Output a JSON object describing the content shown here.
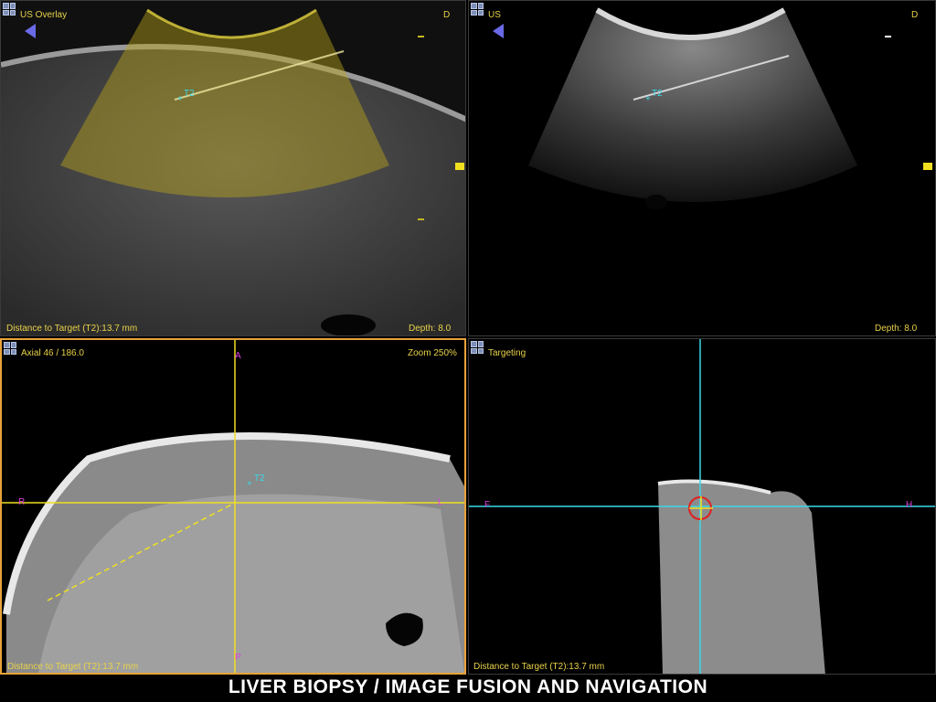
{
  "panels": {
    "us_overlay": {
      "title": "US Overlay",
      "orientation": "D",
      "distance": "Distance to Target (T2):13.7 mm",
      "depth": "Depth: 8.0",
      "target": "T2"
    },
    "us": {
      "title": "US",
      "orientation": "D",
      "depth": "Depth: 8.0",
      "target": "T2"
    },
    "axial": {
      "title": "Axial 46 / 186.0",
      "zoom": "Zoom 250%",
      "distance": "Distance to Target (T2):13.7 mm",
      "target": "T2",
      "markers": {
        "top": "A",
        "bottom": "P",
        "left": "R",
        "right": "L"
      }
    },
    "targeting": {
      "title": "Targeting",
      "distance": "Distance to Target (T2):13.7 mm",
      "markers": {
        "left": "F",
        "right": "H"
      }
    }
  },
  "caption": "LIVER  BIOPSY / IMAGE FUSION AND NAVIGATION",
  "colors": {
    "overlay_label": "#e8d24a",
    "crosshair_axial": "#f0e020",
    "crosshair_target": "#3ad8e8",
    "marker": "#e040e0",
    "target_label": "#3ad8e8",
    "active_border": "#e8a23a"
  },
  "icons": {
    "layout": "grid-layout-icon",
    "probe": "probe-direction-icon"
  }
}
